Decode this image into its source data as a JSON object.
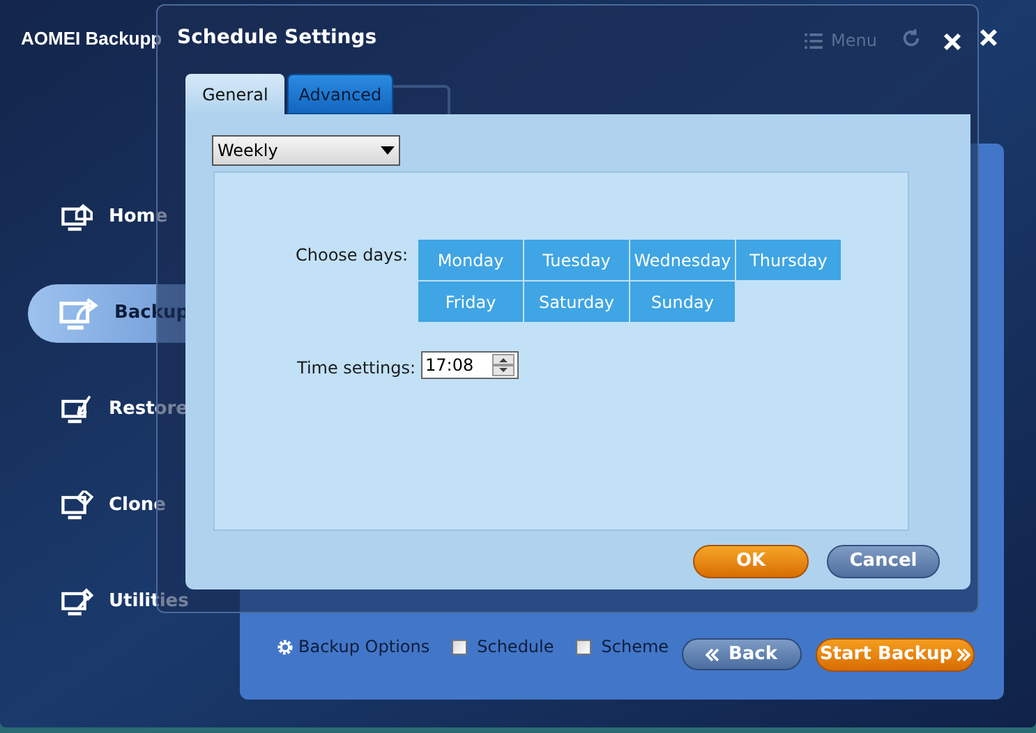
{
  "app": {
    "title": "AOMEI Backupp",
    "menu": "Menu"
  },
  "sidebar": {
    "items": [
      {
        "label": "Home",
        "selected": false,
        "kind": "home"
      },
      {
        "label": "Backup",
        "selected": true,
        "kind": "backup"
      },
      {
        "label": "Restore",
        "selected": false,
        "kind": "restore"
      },
      {
        "label": "Clone",
        "selected": false,
        "kind": "clone"
      },
      {
        "label": "Utilities",
        "selected": false,
        "kind": "utilities"
      }
    ]
  },
  "bottom_bar": {
    "options": "Backup Options",
    "checkboxes": [
      {
        "label": "Schedule",
        "checked": false
      },
      {
        "label": "Scheme",
        "checked": false
      }
    ],
    "back": "Back",
    "start": "Start Backup"
  },
  "dialog": {
    "title": "Schedule Settings",
    "tabs": [
      {
        "label": "General",
        "selected": true
      },
      {
        "label": "Advanced",
        "selected": false
      }
    ],
    "frequency": "Weekly",
    "choose_days_label": "Choose days:",
    "days": [
      "Monday",
      "Tuesday",
      "Wednesday",
      "Thursday",
      "Friday",
      "Saturday",
      "Sunday"
    ],
    "time_label": "Time settings:",
    "time": "17:08",
    "buttons": [
      {
        "label": "OK",
        "kind": "primary"
      },
      {
        "label": "Cancel",
        "kind": "secondary"
      }
    ]
  }
}
